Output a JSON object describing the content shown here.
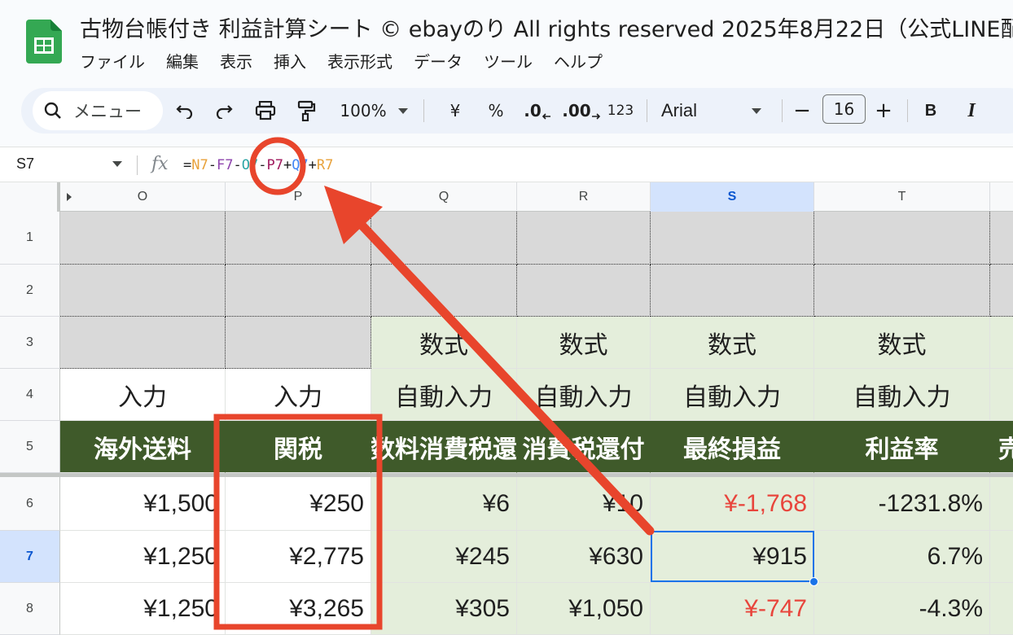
{
  "header": {
    "title": "古物台帳付き 利益計算シート © ebayのり All rights reserved  2025年8月22日（公式LINE配布",
    "menu": [
      "ファイル",
      "編集",
      "表示",
      "挿入",
      "表示形式",
      "データ",
      "ツール",
      "ヘルプ"
    ]
  },
  "toolbar": {
    "search_label": "メニュー",
    "zoom": "100%",
    "currency": "¥",
    "percent": "%",
    "decrease_decimal": ".0",
    "increase_decimal": ".00",
    "number_format": "123",
    "font": "Arial",
    "minus": "−",
    "font_size": "16",
    "plus": "+",
    "bold": "B",
    "italic": "I"
  },
  "formula_bar": {
    "name_box": "S7",
    "fx": "fx",
    "formula_parts": [
      {
        "text": "=",
        "color": "#1f1f1f"
      },
      {
        "text": "N7",
        "color": "#e8a23b"
      },
      {
        "text": "-",
        "color": "#1f1f1f"
      },
      {
        "text": "F7",
        "color": "#8e44ad"
      },
      {
        "text": "-",
        "color": "#1f1f1f"
      },
      {
        "text": "O7",
        "color": "#2ca5a5"
      },
      {
        "text": "-",
        "color": "#1f1f1f"
      },
      {
        "text": "P7",
        "color": "#a0195e"
      },
      {
        "text": "+",
        "color": "#1f1f1f"
      },
      {
        "text": "Q7",
        "color": "#4285f4"
      },
      {
        "text": "+",
        "color": "#1f1f1f"
      },
      {
        "text": "R7",
        "color": "#e8a23b"
      }
    ]
  },
  "columns": [
    "O",
    "P",
    "Q",
    "R",
    "S",
    "T"
  ],
  "rows": [
    "1",
    "2",
    "3",
    "4",
    "5",
    "6",
    "7",
    "8"
  ],
  "sheet": {
    "row3": [
      "",
      "",
      "数式",
      "数式",
      "数式",
      "数式"
    ],
    "row4": [
      "入力",
      "入力",
      "自動入力",
      "自動入力",
      "自動入力",
      "自動入力"
    ],
    "row5": [
      "海外送料",
      "関税",
      "数料消費税還",
      "消費税還付",
      "最終損益",
      "利益率",
      "売"
    ],
    "row6": [
      "¥1,500",
      "¥250",
      "¥6",
      "¥10",
      "¥-1,768",
      "-1231.8%"
    ],
    "row7": [
      "¥1,250",
      "¥2,775",
      "¥245",
      "¥630",
      "¥915",
      "6.7%"
    ],
    "row8": [
      "¥1,250",
      "¥3,265",
      "¥305",
      "¥1,050",
      "¥-747",
      "-4.3%"
    ]
  },
  "colors": {
    "accent_red": "#e8453c",
    "header_green": "#3f5a2a",
    "light_green": "#e4eedb",
    "gray_cell": "#d9d9d9",
    "selection_blue": "#1a73e8"
  }
}
